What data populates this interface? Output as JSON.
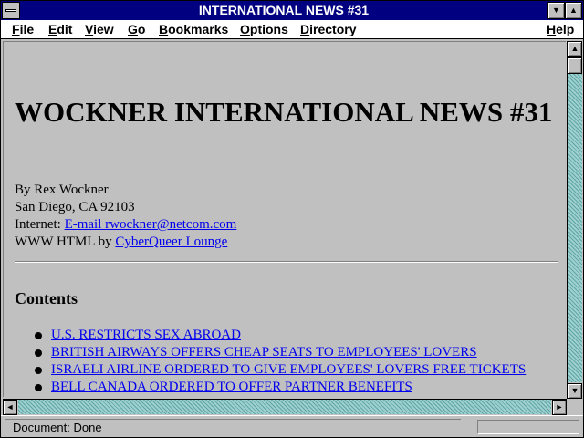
{
  "window": {
    "title": "INTERNATIONAL NEWS #31"
  },
  "menubar": {
    "items": [
      {
        "label": "File"
      },
      {
        "label": "Edit"
      },
      {
        "label": "View"
      },
      {
        "label": "Go"
      },
      {
        "label": "Bookmarks"
      },
      {
        "label": "Options"
      },
      {
        "label": "Directory"
      },
      {
        "label": "Help"
      }
    ]
  },
  "page": {
    "heading": "WOCKNER INTERNATIONAL NEWS #31",
    "byline": "By Rex Wockner",
    "location": "San Diego, CA 92103",
    "internet_label": "Internet:",
    "email_link": "E-mail rwockner@netcom.com",
    "www_label": "WWW HTML by",
    "www_link": "CyberQueer Lounge",
    "contents_heading": "Contents",
    "contents": [
      {
        "label": "U.S. RESTRICTS SEX ABROAD"
      },
      {
        "label": "BRITISH AIRWAYS OFFERS CHEAP SEATS TO EMPLOYEES' LOVERS"
      },
      {
        "label": "ISRAELI AIRLINE ORDERED TO GIVE EMPLOYEES' LOVERS FREE TICKETS"
      },
      {
        "label": "BELL CANADA ORDERED TO OFFER PARTNER BENEFITS"
      }
    ]
  },
  "status": {
    "text": "Document: Done"
  },
  "colors": {
    "titlebar": "#000080",
    "link": "#0000ee",
    "background": "#c0c0c0",
    "scroll_track": "#7fbfbf"
  }
}
